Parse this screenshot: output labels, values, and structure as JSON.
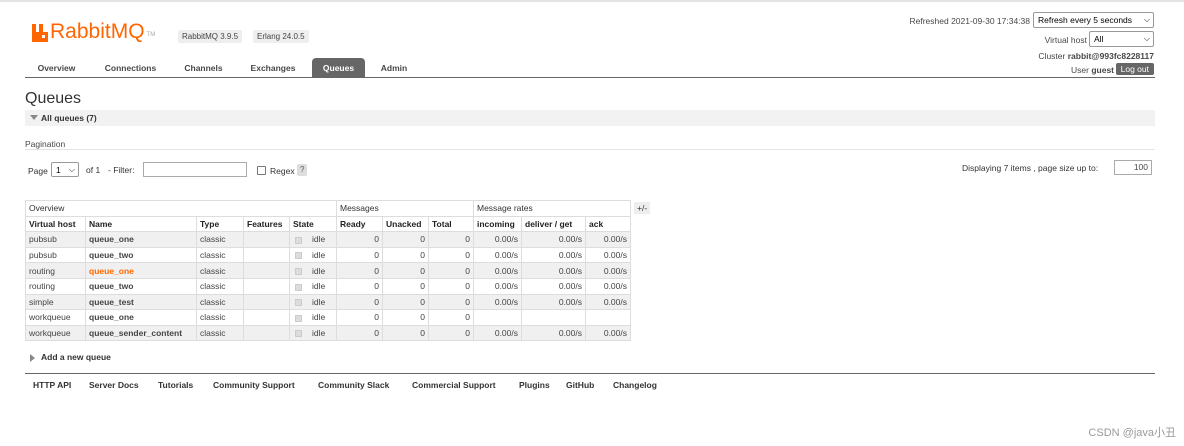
{
  "app": {
    "logo_text": "RabbitMQ",
    "logo_tm": "TM",
    "rabbitmq_version": "RabbitMQ 3.9.5",
    "erlang_version": "Erlang 24.0.5",
    "brand_color": "#ff6600"
  },
  "header": {
    "refreshed_label": "Refreshed 2021-09-30 17:34:38",
    "refresh_select": "Refresh every 5 seconds",
    "vhost_label": "Virtual host",
    "vhost_select": "All",
    "cluster_label": "Cluster",
    "cluster_name": "rabbit@993fc8228117",
    "user_label": "User",
    "user_name": "guest",
    "logout_label": "Log out"
  },
  "nav": {
    "tabs": [
      {
        "label": "Overview"
      },
      {
        "label": "Connections"
      },
      {
        "label": "Channels"
      },
      {
        "label": "Exchanges"
      },
      {
        "label": "Queues",
        "active": true
      },
      {
        "label": "Admin"
      }
    ]
  },
  "page": {
    "title": "Queues",
    "section_label": "All queues (7)"
  },
  "pagination": {
    "title": "Pagination",
    "page_label": "Page",
    "page_value": "1",
    "of_label": "of 1",
    "filter_label": "- Filter:",
    "filter_value": "",
    "regex_label": "Regex",
    "help_label": "?",
    "displaying_label": "Displaying 7 items , page size up to:",
    "page_size": "100"
  },
  "table": {
    "groups": [
      "Overview",
      "Messages",
      "Message rates"
    ],
    "plus_minus": "+/-",
    "columns": [
      "Virtual host",
      "Name",
      "Type",
      "Features",
      "State",
      "Ready",
      "Unacked",
      "Total",
      "incoming",
      "deliver / get",
      "ack"
    ],
    "rows": [
      {
        "vhost": "pubsub",
        "name": "queue_one",
        "type": "classic",
        "features": "",
        "state": "idle",
        "ready": "0",
        "unacked": "0",
        "total": "0",
        "incoming": "0.00/s",
        "deliver": "0.00/s",
        "ack": "0.00/s"
      },
      {
        "vhost": "pubsub",
        "name": "queue_two",
        "type": "classic",
        "features": "",
        "state": "idle",
        "ready": "0",
        "unacked": "0",
        "total": "0",
        "incoming": "0.00/s",
        "deliver": "0.00/s",
        "ack": "0.00/s"
      },
      {
        "vhost": "routing",
        "name": "queue_one",
        "type": "classic",
        "features": "",
        "state": "idle",
        "ready": "0",
        "unacked": "0",
        "total": "0",
        "incoming": "0.00/s",
        "deliver": "0.00/s",
        "ack": "0.00/s"
      },
      {
        "vhost": "routing",
        "name": "queue_two",
        "type": "classic",
        "features": "",
        "state": "idle",
        "ready": "0",
        "unacked": "0",
        "total": "0",
        "incoming": "0.00/s",
        "deliver": "0.00/s",
        "ack": "0.00/s"
      },
      {
        "vhost": "simple",
        "name": "queue_test",
        "type": "classic",
        "features": "",
        "state": "idle",
        "ready": "0",
        "unacked": "0",
        "total": "0",
        "incoming": "0.00/s",
        "deliver": "0.00/s",
        "ack": "0.00/s"
      },
      {
        "vhost": "workqueue",
        "name": "queue_one",
        "type": "classic",
        "features": "",
        "state": "idle",
        "ready": "0",
        "unacked": "0",
        "total": "0",
        "incoming": "",
        "deliver": "",
        "ack": ""
      },
      {
        "vhost": "workqueue",
        "name": "queue_sender_content",
        "type": "classic",
        "features": "",
        "state": "idle",
        "ready": "0",
        "unacked": "0",
        "total": "0",
        "incoming": "0.00/s",
        "deliver": "0.00/s",
        "ack": "0.00/s"
      }
    ]
  },
  "add_queue_label": "Add a new queue",
  "footer": {
    "links": [
      "HTTP API",
      "Server Docs",
      "Tutorials",
      "Community Support",
      "Community Slack",
      "Commercial Support",
      "Plugins",
      "GitHub",
      "Changelog"
    ]
  },
  "watermark": "CSDN @java小丑"
}
